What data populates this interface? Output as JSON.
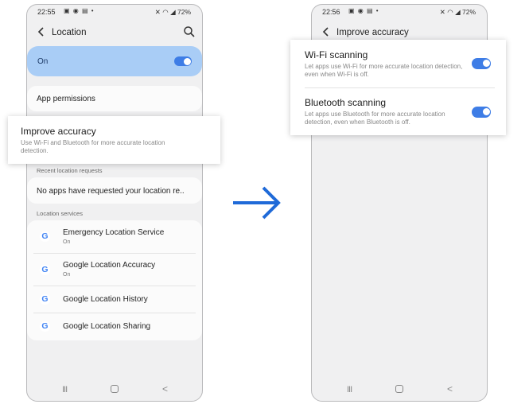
{
  "left_phone": {
    "status_time": "22:55",
    "status_battery": "72%",
    "title": "Location",
    "master_toggle_label": "On",
    "app_permissions": "App permissions",
    "improve_accuracy_title": "Improve accuracy",
    "improve_accuracy_desc": "Use Wi-Fi and Bluetooth for more accurate location detection.",
    "recent_requests_header": "Recent location requests",
    "no_requests": "No apps have requested your location re..",
    "services_header": "Location services",
    "services": [
      {
        "name": "Emergency Location Service",
        "status": "On"
      },
      {
        "name": "Google Location Accuracy",
        "status": "On"
      },
      {
        "name": "Google Location History",
        "status": ""
      },
      {
        "name": "Google Location Sharing",
        "status": ""
      }
    ]
  },
  "right_phone": {
    "status_time": "22:56",
    "status_battery": "72%",
    "title": "Improve accuracy",
    "wifi_title": "Wi-Fi scanning",
    "wifi_desc": "Let apps use Wi-Fi for more accurate location detection, even when Wi-Fi is off.",
    "bt_title": "Bluetooth scanning",
    "bt_desc": "Let apps use Bluetooth for more accurate location detection, even when Bluetooth is off."
  },
  "icons": {
    "google": "G",
    "nav_recent": "III",
    "nav_back": "<"
  },
  "colors": {
    "accent": "#3e7de6",
    "on_card": "#a9cdf6",
    "arrow": "#1f6ad8"
  }
}
